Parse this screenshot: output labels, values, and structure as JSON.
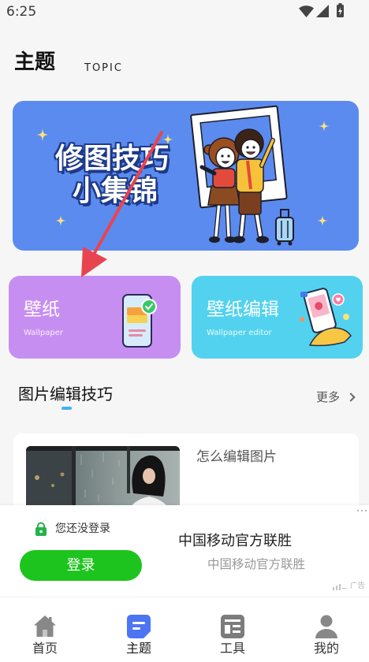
{
  "status_bar": {
    "time": "6:25",
    "icons": [
      "wifi-icon",
      "signal-icon",
      "battery-charging-icon"
    ]
  },
  "header": {
    "title": "主题",
    "subtitle": "TOPIC"
  },
  "banner": {
    "line1": "修图技巧",
    "line2": "小集锦",
    "background": "#5b8bef"
  },
  "feature_cards": [
    {
      "title": "壁纸",
      "subtitle": "Wallpaper",
      "background": "#c78ef2",
      "icon": "wallpaper-phone-icon"
    },
    {
      "title": "壁纸编辑",
      "subtitle": "Wallpaper editor",
      "background": "#52d2ee",
      "icon": "hand-phone-icon"
    }
  ],
  "section": {
    "title": "图片编辑技巧",
    "more_label": "更多"
  },
  "articles": [
    {
      "title": "怎么编辑图片"
    }
  ],
  "ad": {
    "login_prompt": "您还没登录",
    "login_button": "登录",
    "title": "中国移动官方联胜",
    "subtitle": "中国移动官方联胜",
    "label": "广告"
  },
  "bottom_nav": {
    "items": [
      {
        "label": "首页",
        "icon": "home-icon",
        "active": false
      },
      {
        "label": "主题",
        "icon": "topic-icon",
        "active": true
      },
      {
        "label": "工具",
        "icon": "tools-icon",
        "active": false
      },
      {
        "label": "我的",
        "icon": "profile-icon",
        "active": false
      }
    ]
  },
  "colors": {
    "accent": "#4d74f2",
    "login_button": "#1ec41e",
    "section_underline": "#3fb3f4",
    "annotation_arrow": "#e8444f"
  }
}
